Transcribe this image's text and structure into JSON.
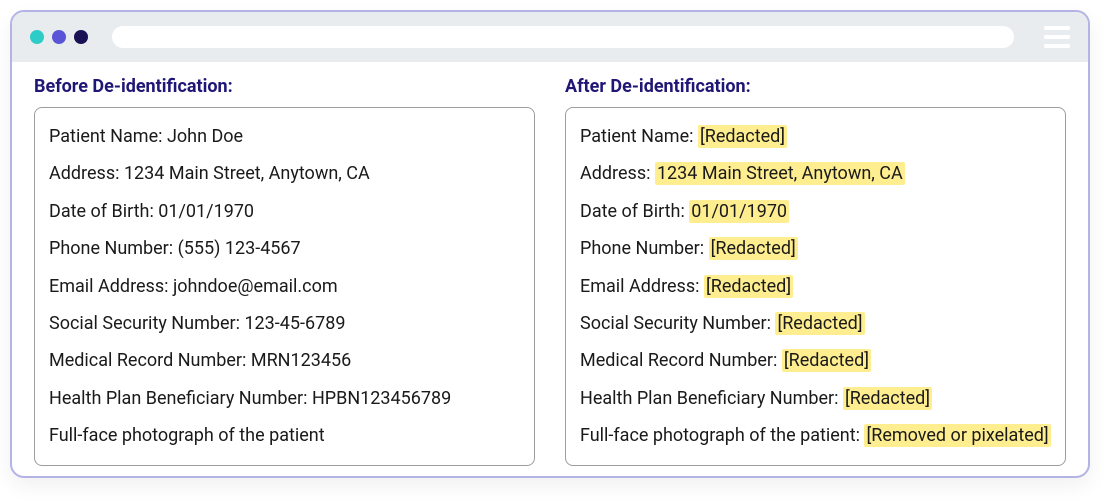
{
  "titlebar": {
    "dots": [
      "teal",
      "mid",
      "dark"
    ]
  },
  "before": {
    "heading": "Before De-identification:",
    "fields": [
      {
        "label": "Patient Name",
        "value": "John Doe"
      },
      {
        "label": "Address",
        "value": "1234 Main Street, Anytown, CA"
      },
      {
        "label": "Date of Birth",
        "value": "01/01/1970"
      },
      {
        "label": "Phone Number",
        "value": "(555) 123-4567"
      },
      {
        "label": "Email Address",
        "value": "johndoe@email.com"
      },
      {
        "label": "Social Security Number",
        "value": "123-45-6789"
      },
      {
        "label": "Medical Record Number",
        "value": "MRN123456"
      },
      {
        "label": "Health Plan Beneficiary Number",
        "value": "HPBN123456789"
      },
      {
        "label": "Full-face photograph of the patient",
        "value": ""
      }
    ]
  },
  "after": {
    "heading": "After De-identification:",
    "fields": [
      {
        "label": "Patient Name",
        "value": "[Redacted]",
        "highlight": true
      },
      {
        "label": "Address",
        "value": "1234 Main Street, Anytown, CA",
        "highlight": true
      },
      {
        "label": "Date of Birth",
        "value": "01/01/1970",
        "highlight": true
      },
      {
        "label": "Phone Number",
        "value": "[Redacted]",
        "highlight": true
      },
      {
        "label": "Email Address",
        "value": "[Redacted]",
        "highlight": true
      },
      {
        "label": "Social Security Number",
        "value": "[Redacted]",
        "highlight": true
      },
      {
        "label": "Medical Record Number",
        "value": "[Redacted]",
        "highlight": true
      },
      {
        "label": "Health Plan Beneficiary Number",
        "value": "[Redacted]",
        "highlight": true
      },
      {
        "label": "Full-face photograph of the patient",
        "value": "[Removed or pixelated]",
        "highlight": true
      }
    ]
  }
}
